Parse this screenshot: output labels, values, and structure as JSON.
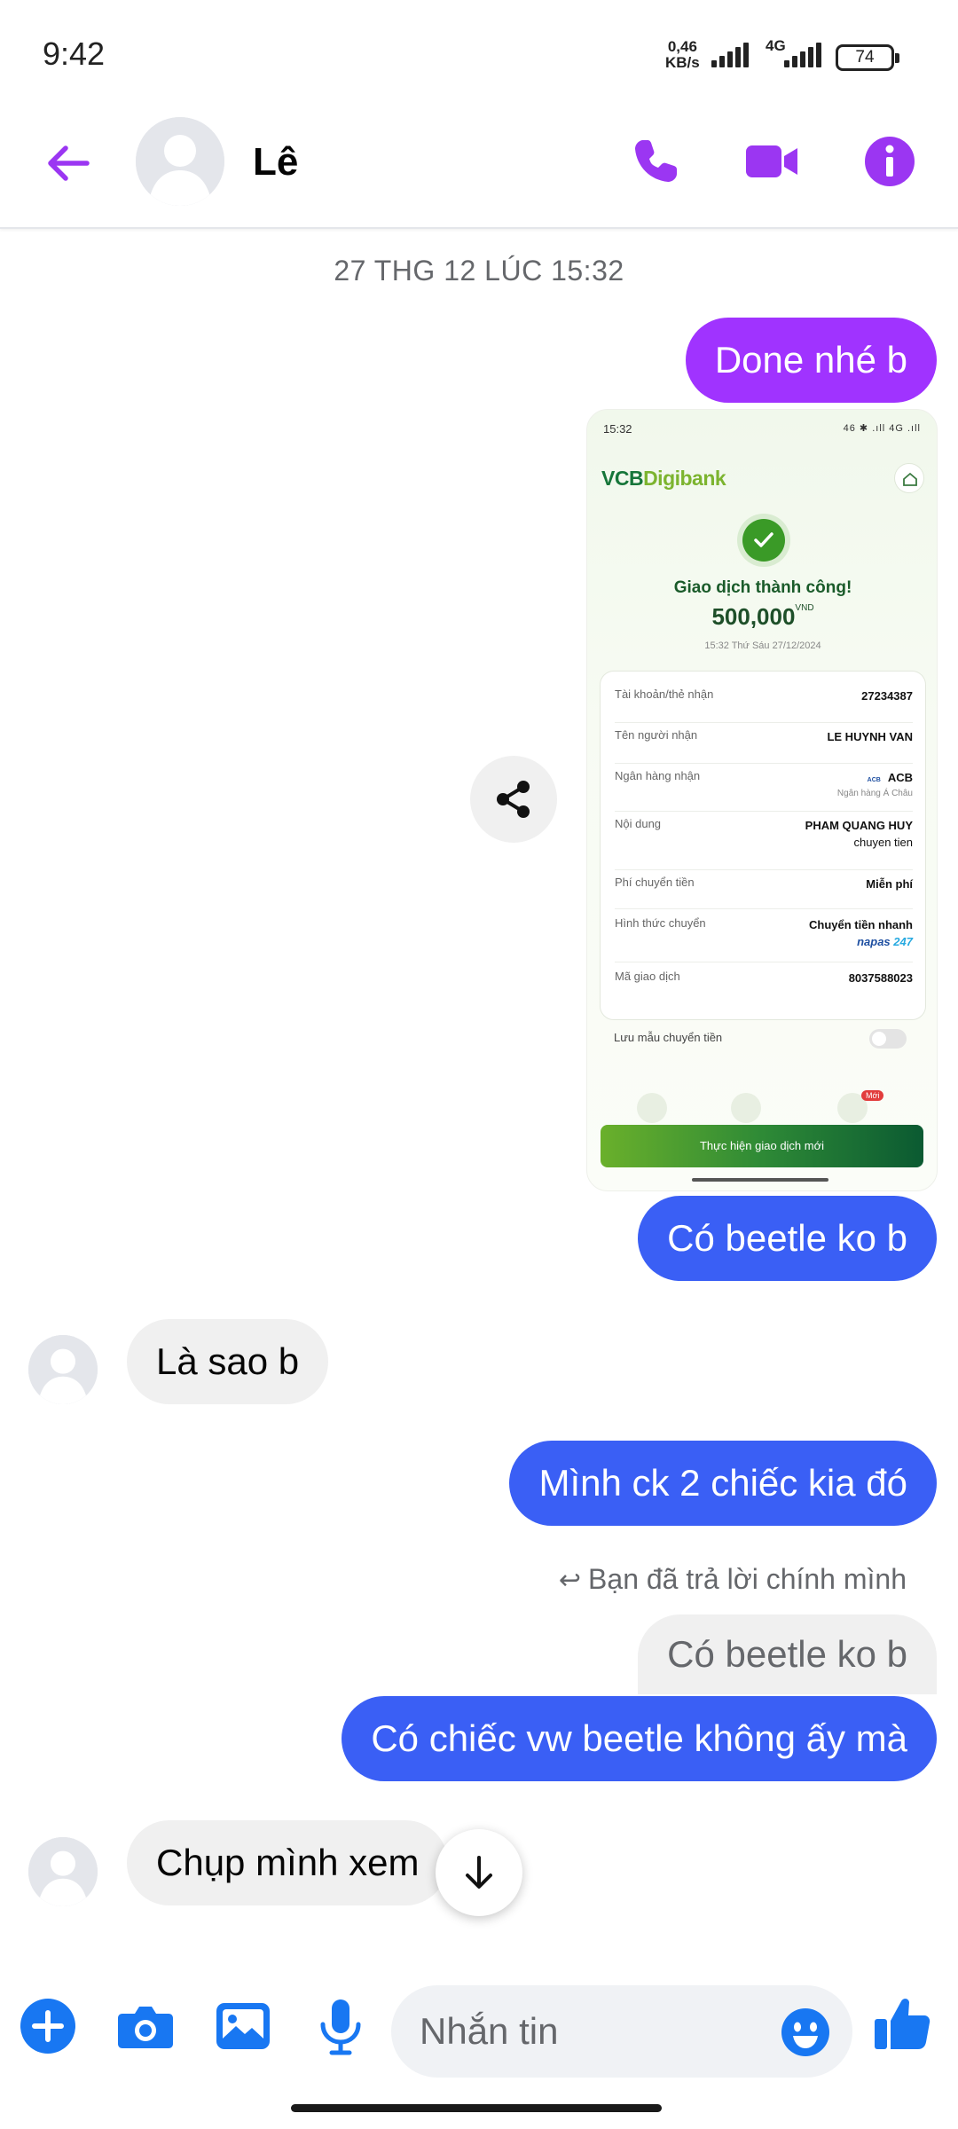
{
  "status_bar": {
    "time": "9:42",
    "net_speed_value": "0,46",
    "net_speed_unit": "KB/s",
    "network_type": "4G",
    "battery": "74"
  },
  "header": {
    "contact_name": "Lê"
  },
  "conversation": {
    "timestamp": "27 THG 12 LÚC 15:32",
    "messages": {
      "m1": "Done nhé b",
      "m2": "Có beetle ko b",
      "m3": "Là sao b",
      "m4": "Mình ck 2 chiếc kia đó",
      "reply_note": "Bạn đã trả lời chính mình",
      "quoted": "Có beetle ko b",
      "m5": "Có chiếc vw beetle không ấy mà",
      "m6": "Chụp mình xem"
    }
  },
  "receipt": {
    "status_time": "15:32",
    "status_icons": "46 ✱ .ıll 4G .ıll",
    "brand_vcb": "VCB",
    "brand_digi": "Digibank",
    "success_text": "Giao dịch thành công!",
    "amount": "500,000",
    "currency": "VND",
    "datetime": "15:32 Thứ Sáu 27/12/2024",
    "rows": [
      {
        "label": "Tài khoản/thẻ nhận",
        "value": "27234387"
      },
      {
        "label": "Tên người nhận",
        "value": "LE HUYNH VAN"
      },
      {
        "label": "Ngân hàng nhận",
        "value": "ACB",
        "logo": "ACB",
        "sub": "Ngân hàng Á Châu"
      },
      {
        "label": "Nội dung",
        "value_line1": "PHAM QUANG HUY",
        "value_line2": "chuyen tien"
      },
      {
        "label": "Phí chuyển tiền",
        "value": "Miễn phí"
      },
      {
        "label": "Hình thức chuyển",
        "value": "Chuyển tiền nhanh",
        "napas": "napas",
        "napas_num": "247"
      },
      {
        "label": "Mã giao dịch",
        "value": "8037588023"
      }
    ],
    "save_template": "Lưu mẫu chuyển tiền",
    "new_badge": "Mới",
    "cta": "Thực hiện giao dịch mới"
  },
  "composer": {
    "placeholder": "Nhắn tin"
  },
  "colors": {
    "accent_purple": "#a033ff",
    "accent_blue": "#3a5ff5",
    "header_icons": "#9b36f2",
    "composer_icons": "#1877f2"
  },
  "icons": [
    "back-arrow-icon",
    "phone-icon",
    "video-camera-icon",
    "info-icon",
    "share-icon",
    "arrow-down-icon",
    "plus-icon",
    "camera-icon",
    "gallery-icon",
    "microphone-icon",
    "emoji-icon",
    "thumbs-up-icon"
  ]
}
